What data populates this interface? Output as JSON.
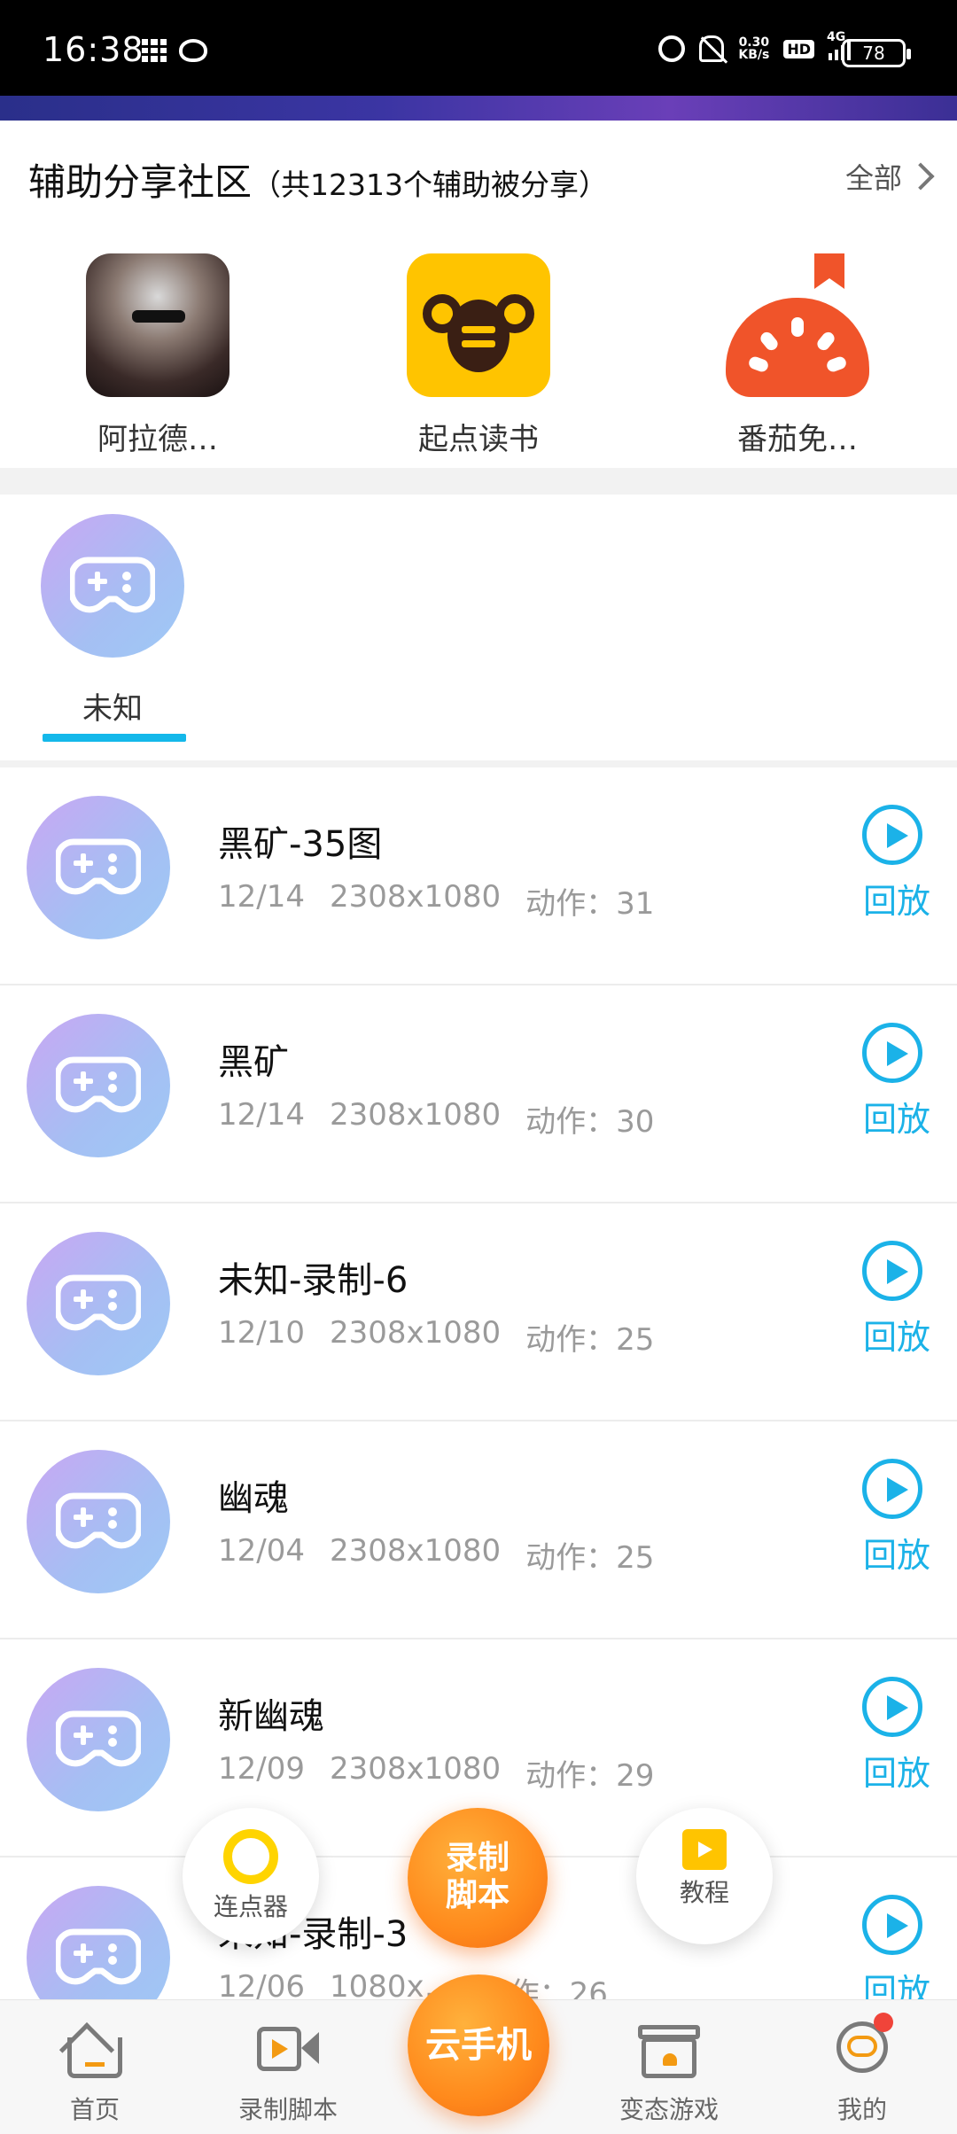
{
  "status_bar": {
    "time": "16:38",
    "net_speed_value": "0.30",
    "net_speed_unit": "KB/s",
    "hd_label": "HD",
    "network": "4G",
    "battery": "78"
  },
  "community": {
    "title": "辅助分享社区",
    "subtitle": "（共12313个辅助被分享）",
    "all_label": "全部",
    "apps": [
      {
        "name": "阿拉德…",
        "icon": "game-warrior-icon"
      },
      {
        "name": "起点读书",
        "icon": "qidian-bee-icon"
      },
      {
        "name": "番茄免…",
        "icon": "tomato-novel-icon"
      }
    ]
  },
  "categories": {
    "selected": "未知",
    "items": [
      {
        "label": "未知",
        "icon": "gamepad-icon"
      }
    ]
  },
  "scripts": [
    {
      "title": "黑矿-35图",
      "date": "12/14",
      "resolution": "2308x1080",
      "actions": "动作：31",
      "play_label": "回放"
    },
    {
      "title": "黑矿",
      "date": "12/14",
      "resolution": "2308x1080",
      "actions": "动作：30",
      "play_label": "回放"
    },
    {
      "title": "未知-录制-6",
      "date": "12/10",
      "resolution": "2308x1080",
      "actions": "动作：25",
      "play_label": "回放"
    },
    {
      "title": "幽魂",
      "date": "12/04",
      "resolution": "2308x1080",
      "actions": "动作：25",
      "play_label": "回放"
    },
    {
      "title": "新幽魂",
      "date": "12/09",
      "resolution": "2308x1080",
      "actions": "动作：29",
      "play_label": "回放"
    },
    {
      "title": "未知-录制-3",
      "date": "12/06",
      "resolution": "1080x…",
      "actions": "动作：26",
      "play_label": "回放"
    }
  ],
  "floating": {
    "clicker_label": "连点器",
    "record_label_1": "录制",
    "record_label_2": "脚本",
    "tutorial_label": "教程"
  },
  "bottom_nav": {
    "home": "首页",
    "record": "录制脚本",
    "cloud_phone": "云手机",
    "mod_games": "变态游戏",
    "mine": "我的"
  },
  "colors": {
    "accent_blue": "#1bb2e8",
    "accent_orange": "#ff8a1c",
    "pad_gradient_start": "#c9a7f3",
    "pad_gradient_end": "#9ec9f6"
  }
}
